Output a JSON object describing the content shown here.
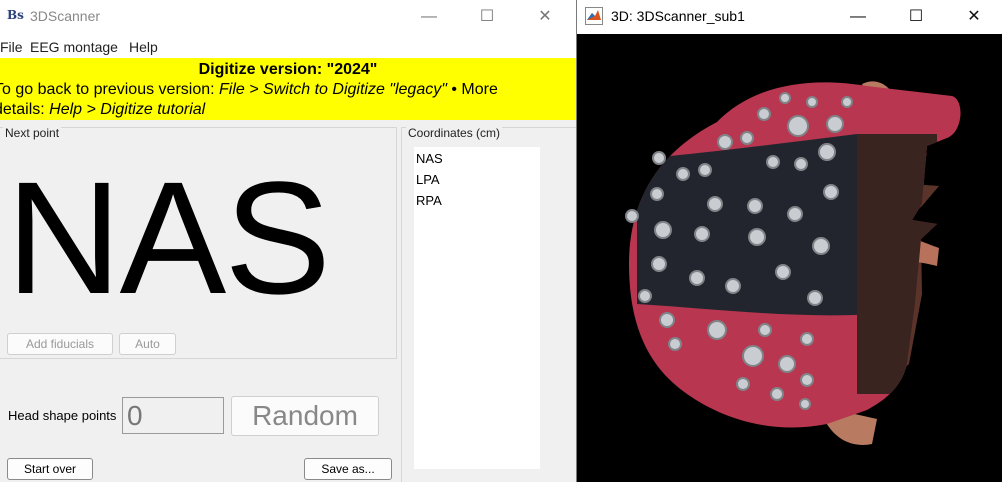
{
  "left_window": {
    "title": "3DScanner",
    "icon": "Bs",
    "controls": {
      "minimize": "—",
      "maximize": "☐",
      "close": "✕"
    },
    "menu": [
      "File",
      "EEG montage",
      "Help"
    ],
    "banner": {
      "title": "Digitize version: \"2024\"",
      "line1_prefix": "To go back to previous version: ",
      "line1_italic": "File > Switch to Digitize \"legacy\"",
      "line1_suffix": "  • More",
      "line2_prefix": "details: ",
      "line2_italic": "Help > Digitize tutorial"
    },
    "next_point": {
      "label": "Next point",
      "value": "NAS",
      "add_fiducials": "Add fiducials",
      "auto": "Auto"
    },
    "head_shape": {
      "label": "Head shape points",
      "value": "0",
      "random": "Random"
    },
    "start_over": "Start over",
    "save_as": "Save as...",
    "coordinates": {
      "label": "Coordinates (cm)",
      "items": [
        "NAS",
        "LPA",
        "RPA"
      ]
    }
  },
  "right_window": {
    "title": "3D: 3DScanner_sub1",
    "controls": {
      "minimize": "—",
      "maximize": "☐",
      "close": "✕"
    },
    "colors": {
      "cap_red": "#b8364f",
      "cap_dark": "#23252e",
      "electrode": "#c9ccd0",
      "skin": "#b87b62"
    }
  }
}
